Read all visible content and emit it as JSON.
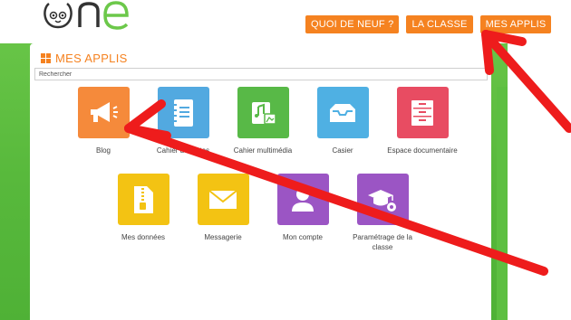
{
  "nav": {
    "items": [
      "QUOI DE NEUF ?",
      "LA CLASSE",
      "MES APPLIS"
    ]
  },
  "panel": {
    "title": "MES APPLIS",
    "search_placeholder": "Rechercher"
  },
  "apps": [
    {
      "label": "Blog",
      "color": "#f58a3b",
      "icon": "megaphone-icon"
    },
    {
      "label": "Cahier de textes",
      "color": "#52a9e0",
      "icon": "notebook-icon"
    },
    {
      "label": "Cahier multimédia",
      "color": "#58b947",
      "icon": "multimedia-icon"
    },
    {
      "label": "Casier",
      "color": "#4fb0e3",
      "icon": "inbox-tray-icon"
    },
    {
      "label": "Espace documentaire",
      "color": "#e84c62",
      "icon": "filing-cabinet-icon"
    },
    {
      "label": "Mes données",
      "color": "#f3c313",
      "icon": "zip-file-icon"
    },
    {
      "label": "Messagerie",
      "color": "#f3c313",
      "icon": "envelope-icon"
    },
    {
      "label": "Mon compte",
      "color": "#9b55c4",
      "icon": "user-icon"
    },
    {
      "label": "Paramétrage de la classe",
      "color": "#9b55c4",
      "icon": "graduation-gear-icon"
    }
  ],
  "annotations": {
    "arrow_color": "#ee1c1c"
  }
}
